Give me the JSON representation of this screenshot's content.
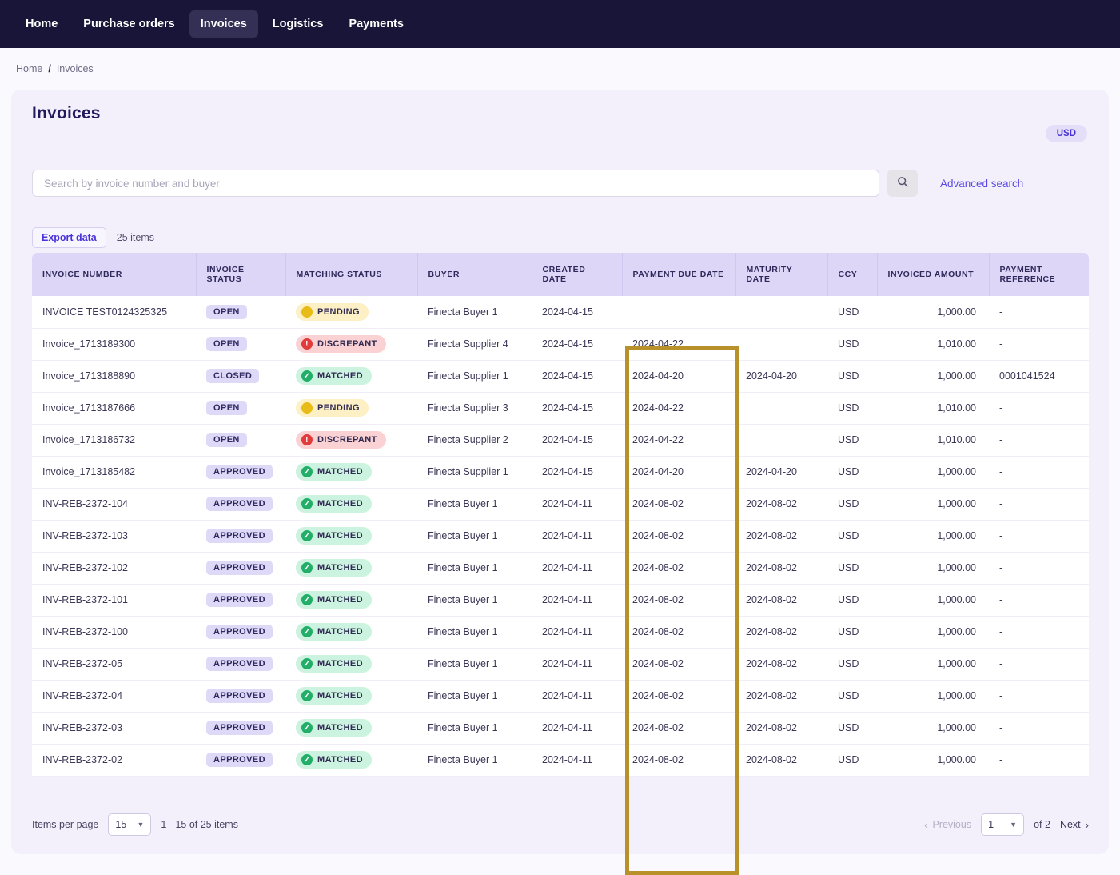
{
  "nav": {
    "items": [
      {
        "label": "Home",
        "active": false
      },
      {
        "label": "Purchase orders",
        "active": false
      },
      {
        "label": "Invoices",
        "active": true
      },
      {
        "label": "Logistics",
        "active": false
      },
      {
        "label": "Payments",
        "active": false
      }
    ]
  },
  "breadcrumb": {
    "home": "Home",
    "separator": "/",
    "current": "Invoices"
  },
  "page": {
    "title": "Invoices",
    "currency_badge": "USD"
  },
  "search": {
    "placeholder": "Search by invoice number and buyer",
    "value": "",
    "icon": "search-icon",
    "advanced_label": "Advanced search"
  },
  "toolbar": {
    "export_label": "Export data",
    "items_count": "25 items"
  },
  "table": {
    "columns": [
      "INVOICE NUMBER",
      "INVOICE STATUS",
      "MATCHING STATUS",
      "BUYER",
      "CREATED DATE",
      "PAYMENT DUE DATE",
      "MATURITY DATE",
      "CCY",
      "INVOICED AMOUNT",
      "PAYMENT REFERENCE"
    ],
    "highlighted_column": "PAYMENT DUE DATE",
    "highlight_color": "#b8912a",
    "rows": [
      {
        "invoice_number": "INVOICE TEST0124325325",
        "invoice_status": "OPEN",
        "matching_status": "PENDING",
        "buyer": "Finecta Buyer 1",
        "created_date": "2024-04-15",
        "payment_due_date": "",
        "maturity_date": "",
        "ccy": "USD",
        "invoiced_amount": "1,000.00",
        "payment_reference": "-"
      },
      {
        "invoice_number": "Invoice_1713189300",
        "invoice_status": "OPEN",
        "matching_status": "DISCREPANT",
        "buyer": "Finecta Supplier 4",
        "created_date": "2024-04-15",
        "payment_due_date": "2024-04-22",
        "maturity_date": "",
        "ccy": "USD",
        "invoiced_amount": "1,010.00",
        "payment_reference": "-"
      },
      {
        "invoice_number": "Invoice_1713188890",
        "invoice_status": "CLOSED",
        "matching_status": "MATCHED",
        "buyer": "Finecta Supplier 1",
        "created_date": "2024-04-15",
        "payment_due_date": "2024-04-20",
        "maturity_date": "2024-04-20",
        "ccy": "USD",
        "invoiced_amount": "1,000.00",
        "payment_reference": "0001041524"
      },
      {
        "invoice_number": "Invoice_1713187666",
        "invoice_status": "OPEN",
        "matching_status": "PENDING",
        "buyer": "Finecta Supplier 3",
        "created_date": "2024-04-15",
        "payment_due_date": "2024-04-22",
        "maturity_date": "",
        "ccy": "USD",
        "invoiced_amount": "1,010.00",
        "payment_reference": "-"
      },
      {
        "invoice_number": "Invoice_1713186732",
        "invoice_status": "OPEN",
        "matching_status": "DISCREPANT",
        "buyer": "Finecta Supplier 2",
        "created_date": "2024-04-15",
        "payment_due_date": "2024-04-22",
        "maturity_date": "",
        "ccy": "USD",
        "invoiced_amount": "1,010.00",
        "payment_reference": "-"
      },
      {
        "invoice_number": "Invoice_1713185482",
        "invoice_status": "APPROVED",
        "matching_status": "MATCHED",
        "buyer": "Finecta Supplier 1",
        "created_date": "2024-04-15",
        "payment_due_date": "2024-04-20",
        "maturity_date": "2024-04-20",
        "ccy": "USD",
        "invoiced_amount": "1,000.00",
        "payment_reference": "-"
      },
      {
        "invoice_number": "INV-REB-2372-104",
        "invoice_status": "APPROVED",
        "matching_status": "MATCHED",
        "buyer": "Finecta Buyer 1",
        "created_date": "2024-04-11",
        "payment_due_date": "2024-08-02",
        "maturity_date": "2024-08-02",
        "ccy": "USD",
        "invoiced_amount": "1,000.00",
        "payment_reference": "-"
      },
      {
        "invoice_number": "INV-REB-2372-103",
        "invoice_status": "APPROVED",
        "matching_status": "MATCHED",
        "buyer": "Finecta Buyer 1",
        "created_date": "2024-04-11",
        "payment_due_date": "2024-08-02",
        "maturity_date": "2024-08-02",
        "ccy": "USD",
        "invoiced_amount": "1,000.00",
        "payment_reference": "-"
      },
      {
        "invoice_number": "INV-REB-2372-102",
        "invoice_status": "APPROVED",
        "matching_status": "MATCHED",
        "buyer": "Finecta Buyer 1",
        "created_date": "2024-04-11",
        "payment_due_date": "2024-08-02",
        "maturity_date": "2024-08-02",
        "ccy": "USD",
        "invoiced_amount": "1,000.00",
        "payment_reference": "-"
      },
      {
        "invoice_number": "INV-REB-2372-101",
        "invoice_status": "APPROVED",
        "matching_status": "MATCHED",
        "buyer": "Finecta Buyer 1",
        "created_date": "2024-04-11",
        "payment_due_date": "2024-08-02",
        "maturity_date": "2024-08-02",
        "ccy": "USD",
        "invoiced_amount": "1,000.00",
        "payment_reference": "-"
      },
      {
        "invoice_number": "INV-REB-2372-100",
        "invoice_status": "APPROVED",
        "matching_status": "MATCHED",
        "buyer": "Finecta Buyer 1",
        "created_date": "2024-04-11",
        "payment_due_date": "2024-08-02",
        "maturity_date": "2024-08-02",
        "ccy": "USD",
        "invoiced_amount": "1,000.00",
        "payment_reference": "-"
      },
      {
        "invoice_number": "INV-REB-2372-05",
        "invoice_status": "APPROVED",
        "matching_status": "MATCHED",
        "buyer": "Finecta Buyer 1",
        "created_date": "2024-04-11",
        "payment_due_date": "2024-08-02",
        "maturity_date": "2024-08-02",
        "ccy": "USD",
        "invoiced_amount": "1,000.00",
        "payment_reference": "-"
      },
      {
        "invoice_number": "INV-REB-2372-04",
        "invoice_status": "APPROVED",
        "matching_status": "MATCHED",
        "buyer": "Finecta Buyer 1",
        "created_date": "2024-04-11",
        "payment_due_date": "2024-08-02",
        "maturity_date": "2024-08-02",
        "ccy": "USD",
        "invoiced_amount": "1,000.00",
        "payment_reference": "-"
      },
      {
        "invoice_number": "INV-REB-2372-03",
        "invoice_status": "APPROVED",
        "matching_status": "MATCHED",
        "buyer": "Finecta Buyer 1",
        "created_date": "2024-04-11",
        "payment_due_date": "2024-08-02",
        "maturity_date": "2024-08-02",
        "ccy": "USD",
        "invoiced_amount": "1,000.00",
        "payment_reference": "-"
      },
      {
        "invoice_number": "INV-REB-2372-02",
        "invoice_status": "APPROVED",
        "matching_status": "MATCHED",
        "buyer": "Finecta Buyer 1",
        "created_date": "2024-04-11",
        "payment_due_date": "2024-08-02",
        "maturity_date": "2024-08-02",
        "ccy": "USD",
        "invoiced_amount": "1,000.00",
        "payment_reference": "-"
      }
    ]
  },
  "footer": {
    "items_per_page_label": "Items per page",
    "items_per_page_value": "15",
    "range_label": "1 - 15 of 25 items",
    "previous_label": "Previous",
    "page_value": "1",
    "of_label": "of 2",
    "next_label": "Next"
  },
  "colors": {
    "nav_bg": "#191538",
    "accent": "#4a33d6",
    "card_bg": "#f3f0fb",
    "header_bg": "#ddd6f7",
    "status_matched": "#23ae68",
    "status_pending": "#e8bb19",
    "status_discrepant": "#e03c3c",
    "highlight": "#b8912a"
  }
}
